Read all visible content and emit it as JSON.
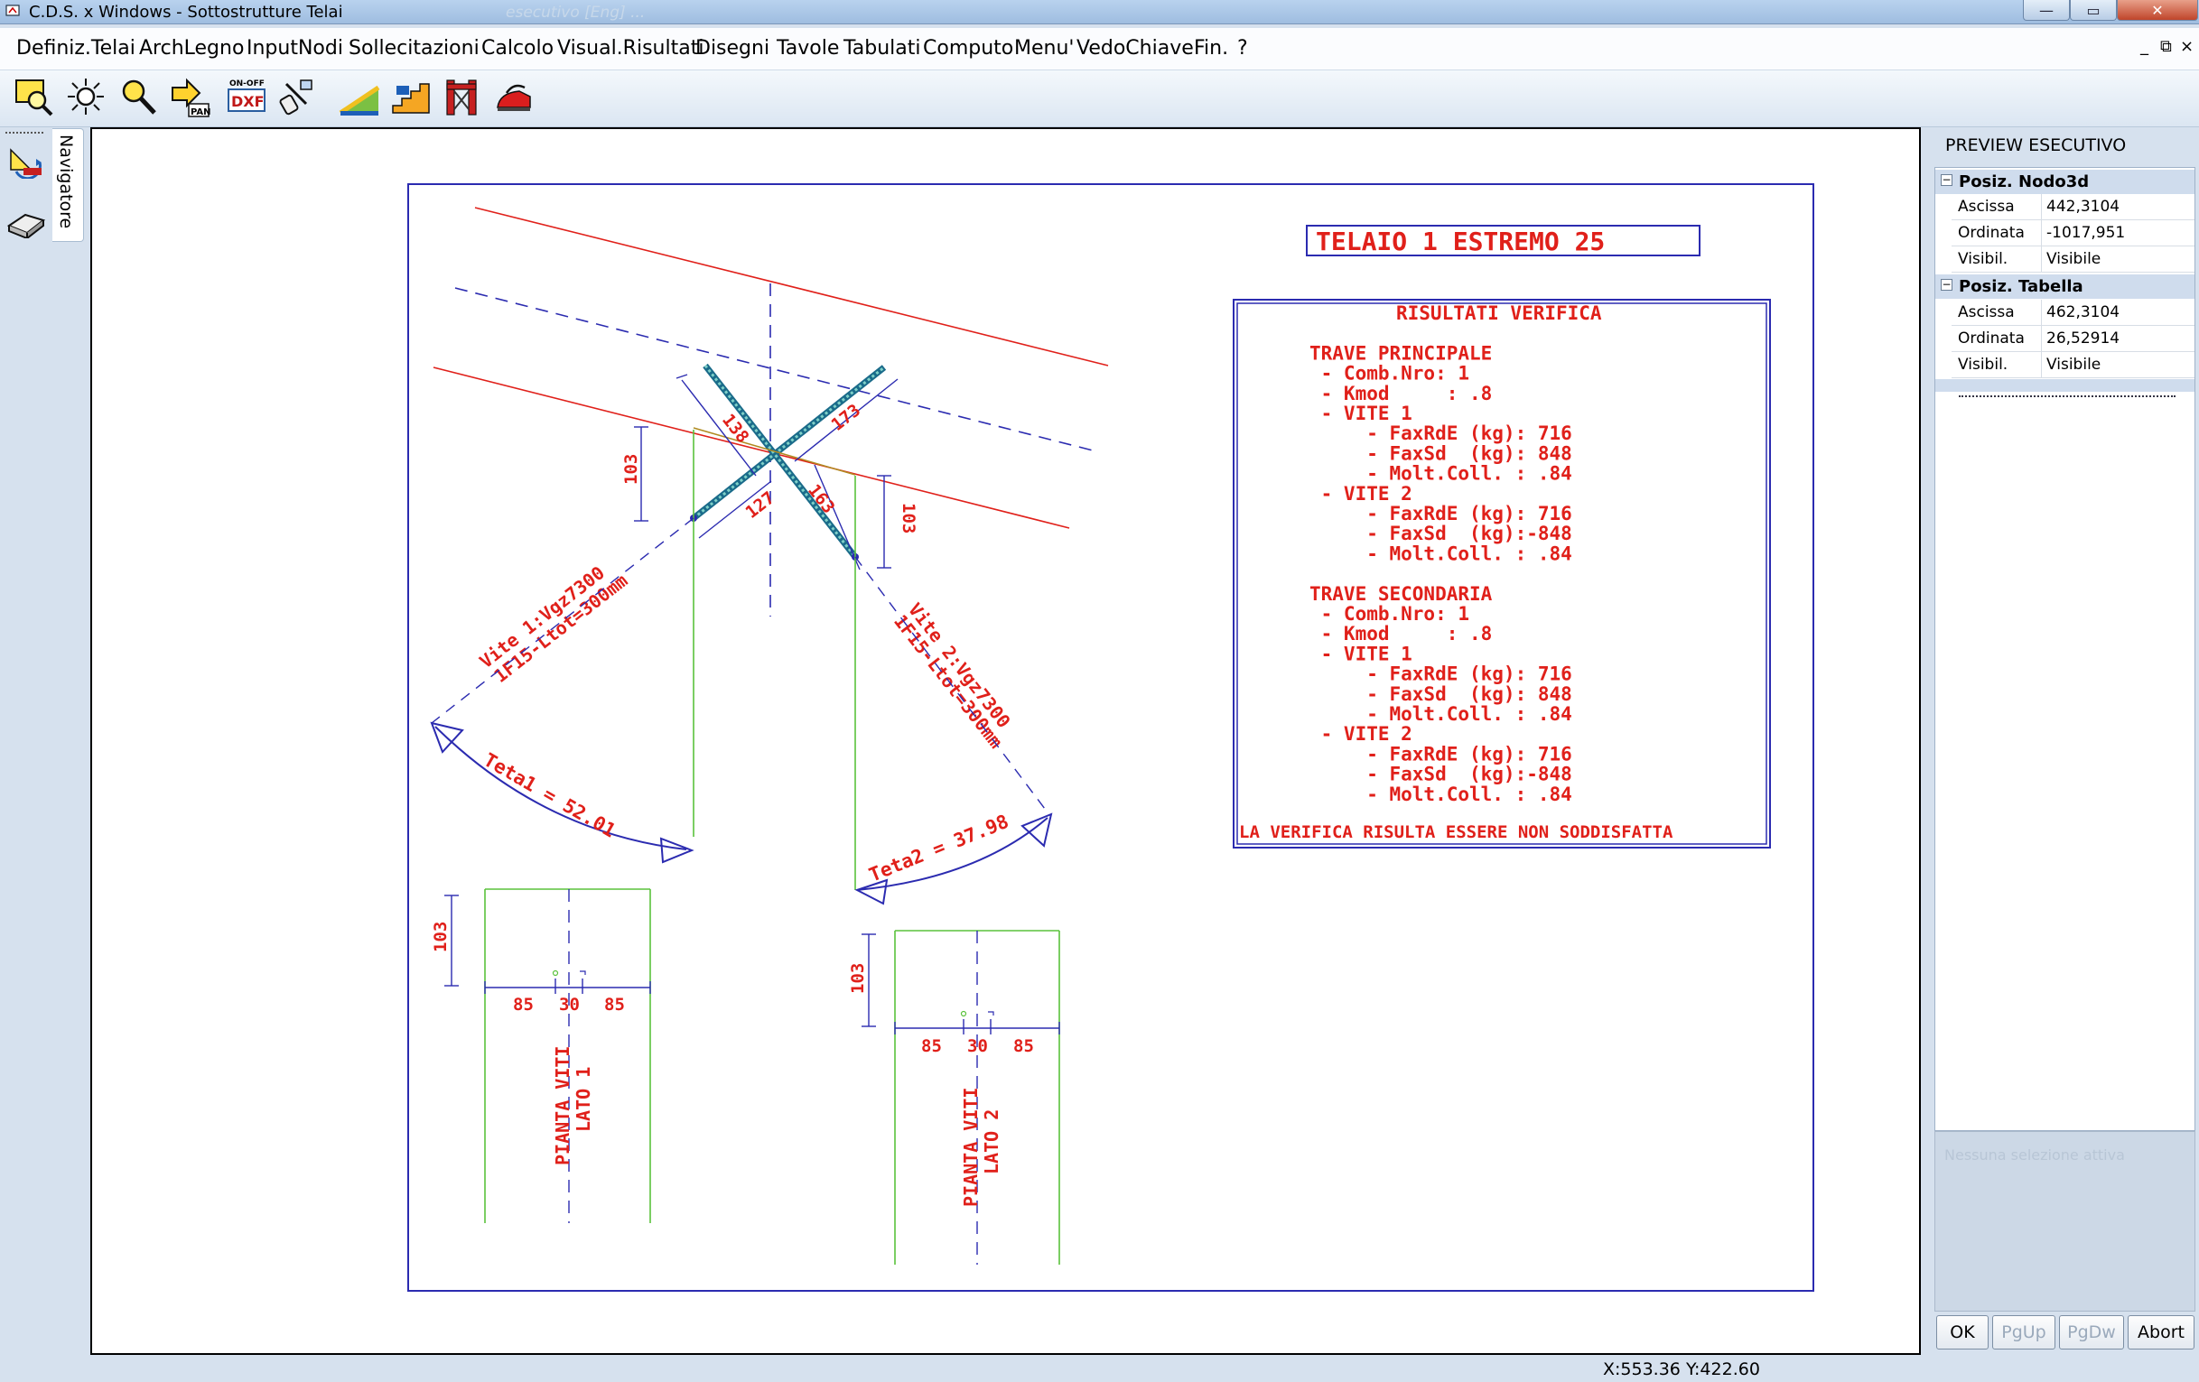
{
  "window": {
    "title": "C.D.S. x Windows - Sottostrutture Telai",
    "title_ghost": "esecutivo   [Eng]  ...",
    "controls": {
      "minimize": "—",
      "maximize": "▭",
      "close": "✕"
    }
  },
  "menu": {
    "items": [
      "Definiz.Telai",
      "ArchLegno",
      "InputNodi",
      "Sollecitazioni",
      "Calcolo",
      "Visual.Risultati",
      "Disegni",
      "Tavole",
      "Tabulati",
      "Computo",
      "Menu'",
      "VedoChiave",
      "Fin.",
      "?"
    ],
    "mdi_controls": [
      "_",
      "⧉",
      "×"
    ]
  },
  "toolbar": {
    "tools": [
      "zoom-window-icon",
      "zoom-extents-icon",
      "zoom-in-icon",
      "pan-icon",
      "on-off-dxf-icon",
      "select-icon",
      "ramp-icon",
      "stair-icon",
      "frame-icon",
      "iron-icon"
    ],
    "dxf_label": "DXF",
    "onoff_label": "ON-OFF",
    "pan_label": "PAN"
  },
  "navigator": {
    "label": "Navigatore"
  },
  "drawing": {
    "title": "TELAIO 1 ESTREMO 25",
    "results_box": {
      "lines": [
        "RISULTATI VERIFICA",
        "",
        "TRAVE PRINCIPALE",
        " - Comb.Nro: 1",
        " - Kmod     : .8",
        " - VITE 1",
        "     - FaxRdE (kg): 716",
        "     - FaxSd  (kg): 848",
        "     - Molt.Coll. : .84",
        " - VITE 2",
        "     - FaxRdE (kg): 716",
        "     - FaxSd  (kg):-848",
        "     - Molt.Coll. : .84",
        "",
        "TRAVE SECONDARIA",
        " - Comb.Nro: 1",
        " - Kmod     : .8",
        " - VITE 1",
        "     - FaxRdE (kg): 716",
        "     - FaxSd  (kg): 848",
        "     - Molt.Coll. : .84",
        " - VITE 2",
        "     - FaxRdE (kg): 716",
        "     - FaxSd  (kg):-848",
        "     - Molt.Coll. : .84"
      ],
      "footer": "LA VERIFICA RISULTA ESSERE NON SODDISFATTA"
    },
    "dims": {
      "d138": "138",
      "d173": "173",
      "d127": "127",
      "d163": "163",
      "d103": "103",
      "d85": "85",
      "d30": "30"
    },
    "screw1": {
      "line1": "Vite 1:Vgz7300",
      "line2": "1F15-Ltot=300mm"
    },
    "screw2": {
      "line1": "Vite 2:Vgz7300",
      "line2": "1F15-Ltot=300mm"
    },
    "teta1": "Teta1 = 52.01",
    "teta2": "Teta2 = 37.98",
    "plan1": {
      "line1": "PIANTA VITI",
      "line2": "LATO 1"
    },
    "plan2": {
      "line1": "PIANTA VITI",
      "line2": "LATO 2"
    }
  },
  "panel": {
    "header": "PREVIEW ESECUTIVO",
    "groups": [
      {
        "label": "Posiz. Nodo3d",
        "toggle": "−",
        "rows": [
          {
            "key": "Ascissa",
            "value": "442,3104"
          },
          {
            "key": "Ordinata",
            "value": "-1017,951"
          },
          {
            "key": "Visibil.",
            "value": "Visibile"
          }
        ]
      },
      {
        "label": "Posiz. Tabella",
        "toggle": "−",
        "rows": [
          {
            "key": "Ascissa",
            "value": "462,3104"
          },
          {
            "key": "Ordinata",
            "value": "26,52914"
          },
          {
            "key": "Visibil.",
            "value": "Visibile"
          }
        ]
      }
    ],
    "lower_faint": "Nessuna selezione attiva",
    "buttons": {
      "ok": "OK",
      "pgup": "PgUp",
      "pgdw": "PgDw",
      "abort": "Abort"
    }
  },
  "status": {
    "coords": "X:553.36  Y:422.60"
  }
}
